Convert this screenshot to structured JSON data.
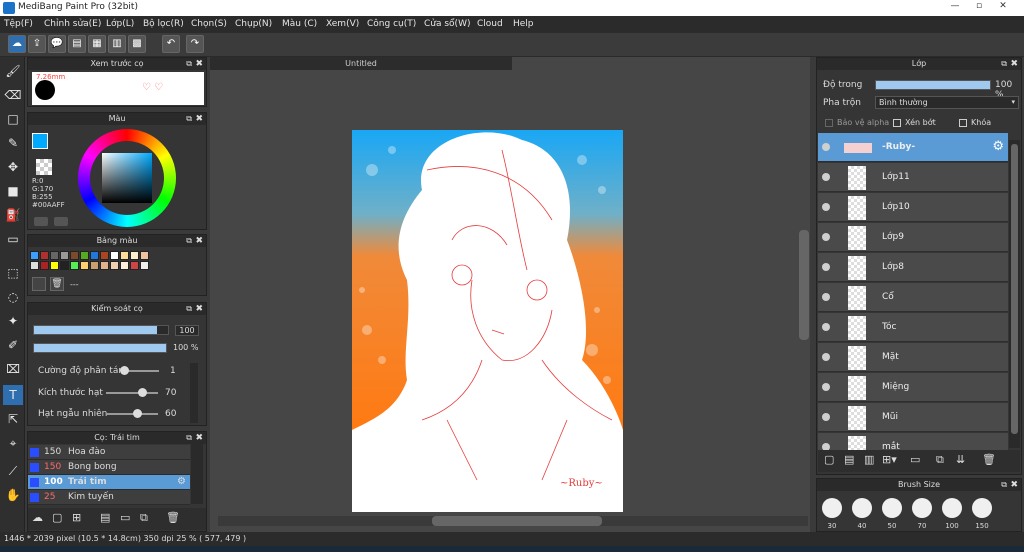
{
  "window": {
    "title": "MediBang Paint Pro (32bit)",
    "controls": [
      "—",
      "▫",
      "✕"
    ]
  },
  "menu": [
    "Tệp(F)",
    "Chỉnh sửa(E)",
    "Lớp(L)",
    "Bộ lọc(R)",
    "Chọn(S)",
    "Chụp(N)",
    "Màu (C)",
    "Xem(V)",
    "Công cụ(T)",
    "Cửa sổ(W)",
    "Cloud",
    "Help"
  ],
  "brush_preview": {
    "title": "Xem trước cọ",
    "size_label": "7.26mm"
  },
  "color": {
    "title": "Màu",
    "r": "R:0",
    "g": "G:170",
    "b": "B:255",
    "hex": "#00AAFF",
    "primary": "#00AAFF",
    "secondary": "#FF7A1A"
  },
  "palette": {
    "title": "Bảng màu",
    "swatches": [
      "#3aa0ff",
      "#b03030",
      "#666666",
      "#999999",
      "#7a4a2a",
      "#55aa22",
      "#2277dd",
      "#aa4422",
      "#ffffff",
      "#ffdd99",
      "#ffeecc",
      "#f0c0a0",
      "#dddddd",
      "#aa2222",
      "#ffff00",
      "#222222",
      "#55ee55",
      "#ffd070",
      "#c8a070",
      "#e0b090",
      "#f0d0b0",
      "#ffeedd",
      "#cc4444",
      "#eeeeee"
    ],
    "more": "---"
  },
  "brush_control": {
    "title": "Kiểm soát cọ",
    "size_value": "100",
    "opacity_value": "100 %",
    "size_fraction": 0.92,
    "opacity_fraction": 1.0,
    "params": [
      {
        "label": "Cường độ phân tán",
        "value": "1",
        "fraction": 0.02
      },
      {
        "label": "Kích thước hạt",
        "value": "70",
        "fraction": 0.7
      },
      {
        "label": "Hạt ngẫu nhiên",
        "value": "60",
        "fraction": 0.6
      }
    ]
  },
  "brush_list": {
    "title": "Cọ: Trái tim",
    "items": [
      {
        "size": "150",
        "name": "Hoa đào",
        "color": "#dddddd",
        "selected": false
      },
      {
        "size": "150",
        "name": "Bong bong",
        "color": "#ff6a6a",
        "selected": false
      },
      {
        "size": "100",
        "name": "Trái tim",
        "color": "#ffffff",
        "selected": true
      },
      {
        "size": "25",
        "name": "Kim tuyến",
        "color": "#ff6a6a",
        "selected": false
      }
    ]
  },
  "canvas": {
    "tab": "Untitled",
    "signature": "~Ruby~"
  },
  "layer_panel": {
    "title": "Lớp",
    "opacity_label": "Độ trong",
    "opacity_value": "100 %",
    "opacity_fraction": 1.0,
    "blend_label": "Pha trộn",
    "blend_value": "Bình thường",
    "protect_alpha": "Bảo vệ alpha",
    "clip": "Xén bớt",
    "lock": "Khóa",
    "layers": [
      {
        "name": "-Ruby-",
        "selected": true
      },
      {
        "name": "Lớp11",
        "selected": false
      },
      {
        "name": "Lớp10",
        "selected": false
      },
      {
        "name": "Lớp9",
        "selected": false
      },
      {
        "name": "Lớp8",
        "selected": false
      },
      {
        "name": "Cổ",
        "selected": false
      },
      {
        "name": "Tóc",
        "selected": false
      },
      {
        "name": "Mặt",
        "selected": false
      },
      {
        "name": "Miệng",
        "selected": false
      },
      {
        "name": "Mũi",
        "selected": false
      },
      {
        "name": "mắt",
        "selected": false
      }
    ]
  },
  "brush_size": {
    "title": "Brush Size",
    "sizes": [
      "30",
      "40",
      "50",
      "70",
      "100",
      "150"
    ]
  },
  "status": {
    "text": "1446 * 2039 pixel  (10.5 * 14.8cm)  350 dpi  25 %  ( 577, 479 )"
  },
  "colors": {
    "accent": "#5b9bd5",
    "panel": "#353535"
  }
}
